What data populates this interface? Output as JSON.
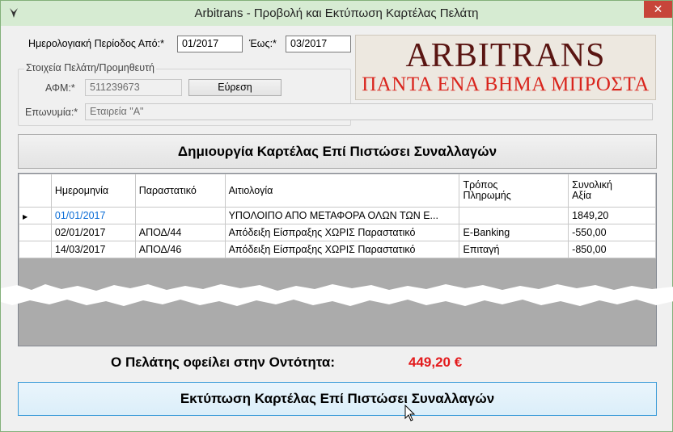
{
  "window": {
    "title": "Arbitrans - Προβολή και Εκτύπωση Καρτέλας Πελάτη",
    "close_glyph": "✕",
    "app_icon": "bird-icon"
  },
  "period": {
    "from_label": "Ημερολογιακή Περίοδος Από:*",
    "from_value": "01/2017",
    "to_label": "Έως:*",
    "to_value": "03/2017"
  },
  "customer_group": {
    "title": "Στοιχεία Πελάτη/Προμηθευτή",
    "afm_label": "ΑΦΜ:*",
    "afm_value": "511239673",
    "find_button": "Εύρεση",
    "name_label": "Επωνυμία:*",
    "name_value": "Εταιρεία \"Α\""
  },
  "logo": {
    "main": "ARBITRANS",
    "sub": "ΠΑΝΤΑ ΕΝΑ ΒΗΜΑ ΜΠΡΟΣΤΑ"
  },
  "create_button": "Δημιουργία Καρτέλας Επί Πιστώσει Συναλλαγών",
  "grid": {
    "headers": [
      "Ημερομηνία",
      "Παραστατικό",
      "Αιτιολογία",
      "Τρόπος\nΠληρωμής",
      "Συνολική\nΑξία"
    ],
    "headers_split": {
      "date": "Ημερομηνία",
      "document": "Παραστατικό",
      "reason": "Αιτιολογία",
      "payment_1": "Τρόπος",
      "payment_2": "Πληρωμής",
      "total_1": "Συνολική",
      "total_2": "Αξία"
    },
    "current_row_glyph": "▶",
    "rows": [
      {
        "date": "01/01/2017",
        "document": "",
        "reason": "ΥΠΟΛΟΙΠΟ ΑΠΟ ΜΕΤΑΦΟΡΑ ΟΛΩΝ ΤΩΝ Ε...",
        "payment": "",
        "total": "1849,20"
      },
      {
        "date": "02/01/2017",
        "document": "ΑΠΟΔ/44",
        "reason": "Απόδειξη Είσπραξης ΧΩΡΙΣ Παραστατικό",
        "payment": "E-Banking",
        "total": "-550,00"
      },
      {
        "date": "14/03/2017",
        "document": "ΑΠΟΔ/46",
        "reason": "Απόδειξη Είσπραξης ΧΩΡΙΣ Παραστατικό",
        "payment": "Επιταγή",
        "total": "-850,00"
      }
    ]
  },
  "balance": {
    "label": "Ο Πελάτης οφείλει στην Οντότητα:",
    "value": "449,20 €"
  },
  "print_button": "Εκτύπωση Καρτέλας Επί Πιστώσει Συναλλαγών",
  "colors": {
    "titlebar": "#d6ebd2",
    "close": "#c7453a",
    "logo_main": "#5a1512",
    "logo_sub": "#d9251d",
    "balance_value": "#e31a1c",
    "print_border": "#3c9bd8"
  }
}
